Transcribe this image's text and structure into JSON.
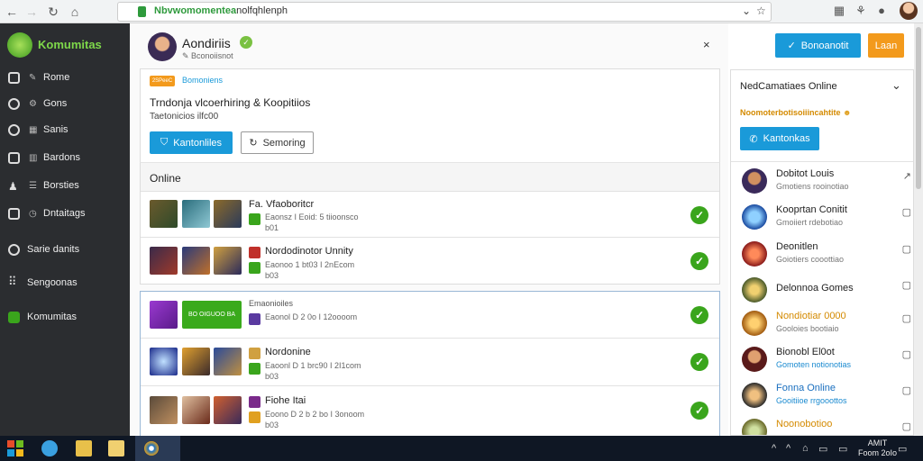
{
  "browser": {
    "url": "Nbvwomomenteanolfqhlenph",
    "url_prefix": "Nbvwomomentea",
    "url_rest": "nolfqhlenph"
  },
  "sidebar": {
    "brand": "Komumitas",
    "items": [
      {
        "label": "Rome",
        "icon": "monitor-icon"
      },
      {
        "label": "Gons",
        "icon": "target-icon"
      },
      {
        "label": "Sanis",
        "icon": "circle-icon"
      },
      {
        "label": "Bardons",
        "icon": "folder-icon"
      },
      {
        "label": "Borsties",
        "icon": "person-icon"
      },
      {
        "label": "Dntaitags",
        "icon": "export-icon"
      },
      {
        "label": "Sarie danits",
        "icon": "user-circle-icon"
      },
      {
        "label": "Sengoonas",
        "icon": "grid-icon"
      },
      {
        "label": "Komumitas",
        "icon": "green-square-icon"
      }
    ]
  },
  "header": {
    "name": "Aondiriis",
    "sub": "Bconoiisnot",
    "close": "×"
  },
  "top_actions": {
    "primary": "Bonoanotit",
    "secondary": "Laan"
  },
  "panel1": {
    "badge": "2SPeeC",
    "badge_label": "Bomoniens",
    "title": "Trndonja vlcoerhiring & Koopitiios",
    "subtitle": "Taetonicios ilfc00",
    "primary_btn": "Kantonliles",
    "secondary_btn": "Semoring"
  },
  "online": {
    "header": "Online",
    "rows": [
      {
        "title": "Fa. Vfaoboritcr",
        "sub1": "Eaonsz I Eoid: 5 tiioonsco",
        "sub2": "b01",
        "check": "✓"
      },
      {
        "title": "Nordodinotor Unnity",
        "sub1": "Eaonoo 1 bt03 I 2nEcom",
        "sub2": "b03",
        "check": "✓"
      }
    ]
  },
  "panel2": {
    "rows": [
      {
        "title": "Emaonioiles",
        "badge": "BO OIGUOO BA",
        "sub1": "Eaonol D 2 0o I 12oooom",
        "sub2": "",
        "check": "✓"
      },
      {
        "title": "Nordonine",
        "sub1": "Eaoonl D 1 brc90 I 2I1com",
        "sub2": "b03",
        "check": "✓"
      },
      {
        "title": "Fiohe Itai",
        "sub1": "Eoono D 2 b 2 bo I 3onoom",
        "sub2": "b03",
        "check": "✓"
      }
    ]
  },
  "right_panel": {
    "title": "NedCamatiaes Online",
    "notice": "Noomoterbotisoiiincahtite",
    "connect_btn": "Kantonkas",
    "friends": [
      {
        "name": "Dobitot Louis",
        "sub": "Gmotiens rooinotiao",
        "name_color": "#222"
      },
      {
        "name": "Kooprtan Conitit",
        "sub": "Gmoiiert rdebotiao",
        "name_color": "#222"
      },
      {
        "name": "Deonitlen",
        "sub": "Goiotiers cooottiao",
        "name_color": "#222"
      },
      {
        "name": "Delonnoa Gomes",
        "sub": "",
        "name_color": "#222"
      },
      {
        "name": "Nondiotiar 0000",
        "sub": "Gooloies bootiaio",
        "name_color": "#d48a00"
      },
      {
        "name": "Bionobl El0ot",
        "sub": "Gomoten notionotias",
        "name_color": "#222"
      },
      {
        "name": "Fonna Online",
        "sub": "Gooitiioe rrgooottos",
        "name_color": "#1a6fbf"
      },
      {
        "name": "Noonobotioo",
        "sub": "",
        "name_color": "#d48a00"
      }
    ]
  },
  "taskbar": {
    "time": "AMIT",
    "date": "Foom 2oIo"
  },
  "colors": {
    "accent_blue": "#1a9ad9",
    "accent_orange": "#f39a1c",
    "check_green": "#3aa51c",
    "brand_green": "#7ed84a"
  }
}
